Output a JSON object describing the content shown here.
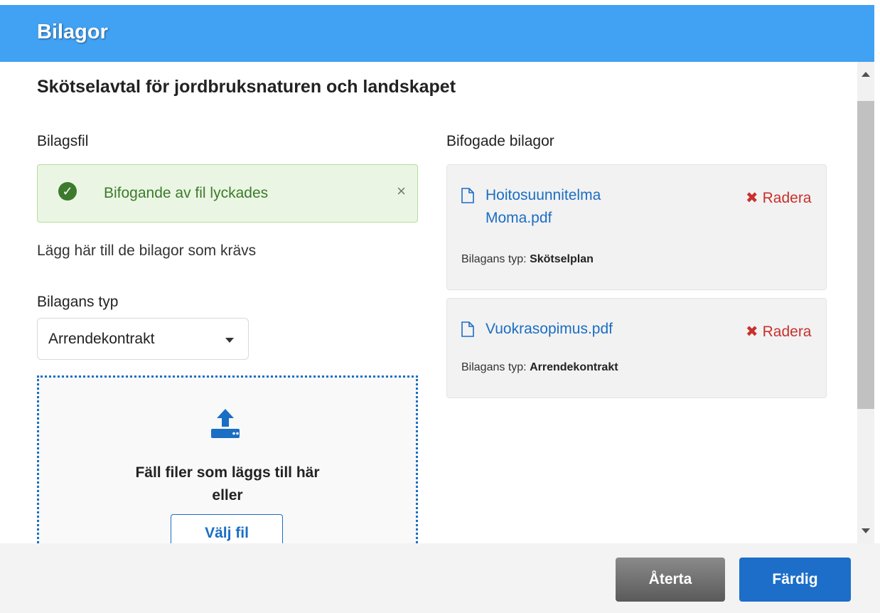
{
  "header": {
    "title": "Bilagor"
  },
  "section": {
    "title": "Skötselavtal för jordbruksnaturen och landskapet"
  },
  "upload": {
    "label": "Bilagsfil",
    "alert": {
      "icon": "check-circle-icon",
      "message": "Bifogande av fil lyckades",
      "close": "×"
    },
    "help": "Lägg här till de bilagor som krävs",
    "type_label": "Bilagans typ",
    "type_value": "Arrendekontrakt",
    "dropzone": {
      "icon": "upload-icon",
      "line1": "Fäll filer som läggs till här",
      "line2": "eller",
      "button": "Välj fil"
    }
  },
  "attachments": {
    "label": "Bifogade bilagor",
    "items": [
      {
        "name_line1": "Hoitosuunnitelma",
        "name_line2": "Moma.pdf",
        "delete": "Radera",
        "type_label": "Bilagans typ:",
        "type_value": "Skötselplan"
      },
      {
        "name_line1": "Vuokrasopimus.pdf",
        "name_line2": "",
        "delete": "Radera",
        "type_label": "Bilagans typ:",
        "type_value": "Arrendekontrakt"
      }
    ]
  },
  "footer": {
    "cancel": "Återta",
    "done": "Färdig"
  },
  "colors": {
    "header": "#41a1f2",
    "primary": "#1c6ec8",
    "success": "#3d7a2d",
    "danger": "#c9302c"
  }
}
